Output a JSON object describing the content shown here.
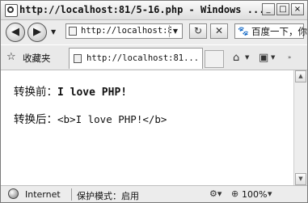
{
  "window": {
    "title": "http://localhost:81/5-16.php - Windows ..."
  },
  "toolbar": {
    "address": "http://localhost:8",
    "search_text": "百度一下，你"
  },
  "tabs": {
    "favorites_label": "收藏夹",
    "active_tab_label": "http://localhost:81..."
  },
  "content": {
    "line1_label": "转换前：",
    "line1_value": "I love PHP!",
    "line2_label": "转换后：",
    "line2_value": "<b>I love PHP!</b>"
  },
  "status": {
    "zone": "Internet",
    "protected_mode": "保护模式：启用",
    "zoom": "100%"
  },
  "icons": {
    "back": "back-arrow-icon",
    "forward": "forward-arrow-icon",
    "refresh": "refresh-icon",
    "stop": "stop-icon",
    "search_provider": "baidu-paw-icon",
    "favorites": "star-icon",
    "home": "home-icon",
    "feeds": "rss-icon",
    "globe": "globe-icon",
    "zoom": "magnifier-icon"
  }
}
